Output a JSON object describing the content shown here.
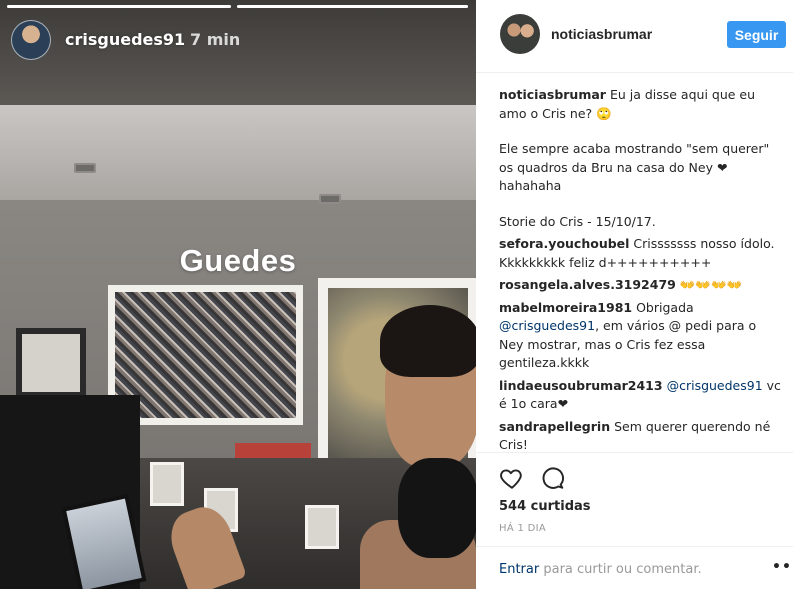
{
  "story": {
    "username": "crisguedes91",
    "time_ago": "7 min",
    "caption_text": "Guedes",
    "segments": [
      {
        "progress": 1.0
      },
      {
        "progress": 1.0
      }
    ]
  },
  "post": {
    "username": "noticiasbrumar",
    "follow_label": "Seguir",
    "caption": {
      "user": "noticiasbrumar",
      "line1": "Eu ja disse aqui que eu amo o Cris ne? 🙄",
      "line2": "Ele sempre acaba mostrando \"sem querer\" os quadros da Bru na casa do Ney ❤ hahahaha",
      "line3": "Storie do Cris - 15/10/17."
    },
    "comments": [
      {
        "user": "sefora.youchoubel",
        "text": "Crisssssss nosso ídolo. Kkkkkkkkk feliz d++++++++++"
      },
      {
        "user": "rosangela.alves.3192479",
        "text": "👐👐👐👐"
      },
      {
        "user": "mabelmoreira1981",
        "pre": "Obrigada",
        "mention": "@crisguedes91",
        "text": ", em vários @ pedi para o Ney mostrar, mas o Cris fez essa gentileza.kkkk"
      },
      {
        "user": "lindaeusoubrumar2413",
        "mention": "@crisguedes91",
        "text": "vc é 1o cara❤"
      },
      {
        "user": "sandrapellegrin",
        "text": "Sem querer querendo né Cris!"
      }
    ],
    "likes": "544 curtidas",
    "time_ago": "HÁ 1 DIA",
    "login_link": "Entrar",
    "login_text": " para curtir ou comentar.",
    "more": "•••",
    "icons": {
      "like": "heart-icon",
      "comment": "comment-icon"
    }
  }
}
